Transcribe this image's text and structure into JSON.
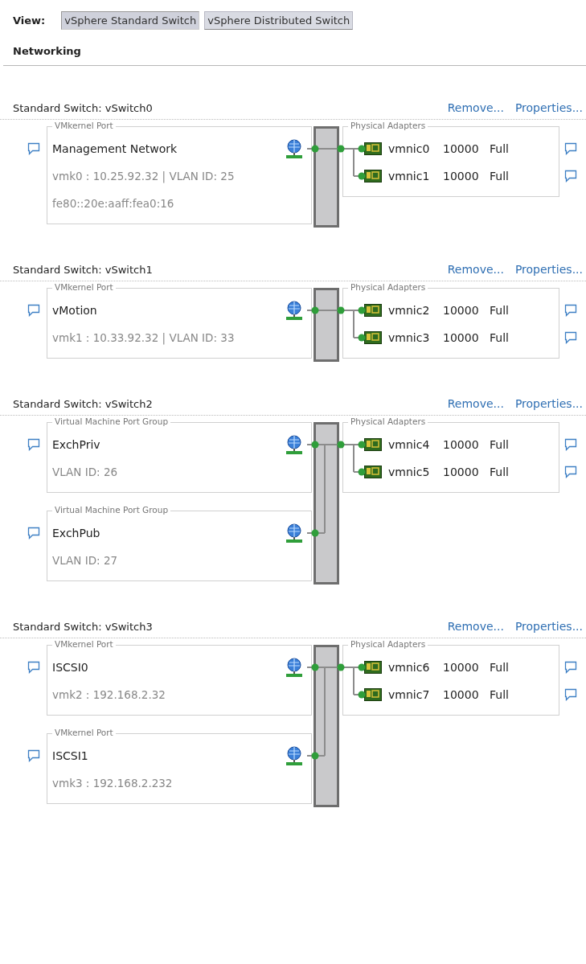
{
  "view": {
    "label": "View:",
    "options": [
      {
        "label": "vSphere Standard Switch",
        "selected": true
      },
      {
        "label": "vSphere Distributed Switch",
        "selected": false
      }
    ]
  },
  "heading": "Networking",
  "switches": [
    {
      "title": "Standard Switch: vSwitch0",
      "actions": [
        "Remove...",
        "Properties..."
      ],
      "ports": [
        {
          "group": "VMkernel Port",
          "name": "Management Network",
          "details": [
            "vmk0 : 10.25.92.32 | VLAN ID: 25",
            "fe80::20e:aaff:fea0:16"
          ]
        }
      ],
      "adapters_label": "Physical Adapters",
      "adapters": [
        {
          "name": "vmnic0",
          "speed": "10000",
          "duplex": "Full"
        },
        {
          "name": "vmnic1",
          "speed": "10000",
          "duplex": "Full"
        }
      ]
    },
    {
      "title": "Standard Switch: vSwitch1",
      "actions": [
        "Remove...",
        "Properties..."
      ],
      "ports": [
        {
          "group": "VMkernel Port",
          "name": "vMotion",
          "details": [
            "vmk1 : 10.33.92.32 | VLAN ID: 33"
          ]
        }
      ],
      "adapters_label": "Physical Adapters",
      "adapters": [
        {
          "name": "vmnic2",
          "speed": "10000",
          "duplex": "Full"
        },
        {
          "name": "vmnic3",
          "speed": "10000",
          "duplex": "Full"
        }
      ]
    },
    {
      "title": "Standard Switch: vSwitch2",
      "actions": [
        "Remove...",
        "Properties..."
      ],
      "ports": [
        {
          "group": "Virtual Machine Port Group",
          "name": "ExchPriv",
          "details": [
            "VLAN ID: 26"
          ]
        },
        {
          "group": "Virtual Machine Port Group",
          "name": "ExchPub",
          "details": [
            "VLAN ID: 27"
          ]
        }
      ],
      "adapters_label": "Physical Adapters",
      "adapters": [
        {
          "name": "vmnic4",
          "speed": "10000",
          "duplex": "Full"
        },
        {
          "name": "vmnic5",
          "speed": "10000",
          "duplex": "Full"
        }
      ]
    },
    {
      "title": "Standard Switch: vSwitch3",
      "actions": [
        "Remove...",
        "Properties..."
      ],
      "ports": [
        {
          "group": "VMkernel Port",
          "name": "ISCSI0",
          "details": [
            "vmk2 : 192.168.2.32"
          ]
        },
        {
          "group": "VMkernel Port",
          "name": "ISCSI1",
          "details": [
            "vmk3 : 192.168.2.232"
          ]
        }
      ],
      "adapters_label": "Physical Adapters",
      "adapters": [
        {
          "name": "vmnic6",
          "speed": "10000",
          "duplex": "Full"
        },
        {
          "name": "vmnic7",
          "speed": "10000",
          "duplex": "Full"
        }
      ]
    }
  ]
}
